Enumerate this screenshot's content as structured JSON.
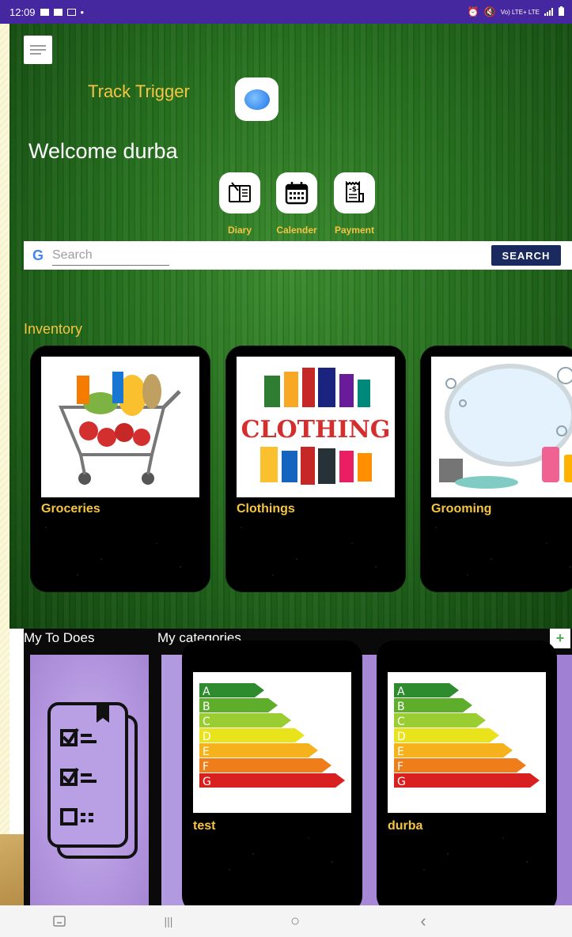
{
  "status_bar": {
    "time": "12:09",
    "dot": "•",
    "network": "Vo) LTE+ LTE",
    "left_icons": [
      "gallery-icon",
      "screen-icon",
      "video-icon"
    ],
    "right_icons": [
      "alarm-icon",
      "mute-icon",
      "signal-icon",
      "battery-icon"
    ]
  },
  "header": {
    "app_name": "Track Trigger",
    "welcome": "Welcome durba"
  },
  "quick_actions": [
    {
      "label": "Diary",
      "icon": "diary-icon"
    },
    {
      "label": "Calender",
      "icon": "calendar-icon"
    },
    {
      "label": "Payment",
      "icon": "receipt-icon"
    }
  ],
  "search": {
    "logo": "G",
    "placeholder": "Search",
    "button_label": "SEARCH"
  },
  "inventory": {
    "title": "Inventory",
    "items": [
      {
        "label": "Groceries",
        "image": "grocery-cart-image"
      },
      {
        "label": "Clothings",
        "image": "clothing-collage-image",
        "image_text": "CLOTHING"
      },
      {
        "label": "Grooming",
        "image": "mirror-toiletries-image"
      }
    ]
  },
  "todo": {
    "title": "My To Does",
    "icon": "checklist-icon"
  },
  "categories": {
    "title": "My categories",
    "add_label": "+",
    "items": [
      {
        "label": "test",
        "image": "energy-rating-image"
      },
      {
        "label": "durba",
        "image": "energy-rating-image"
      }
    ],
    "energy_letters": [
      "A",
      "B",
      "C",
      "D",
      "E",
      "F",
      "G"
    ],
    "energy_colors": [
      "#2e8b2e",
      "#5fae2b",
      "#9acd32",
      "#e8e31a",
      "#f5b21c",
      "#ef7d1a",
      "#d92020"
    ]
  },
  "nav_bar": {
    "recents": "|||",
    "home": "○",
    "back": "‹"
  },
  "colors": {
    "status_bar": "#4527a0",
    "accent_yellow": "#f5c542",
    "search_button": "#1a2a5e",
    "todo_purple": "#b497df"
  }
}
